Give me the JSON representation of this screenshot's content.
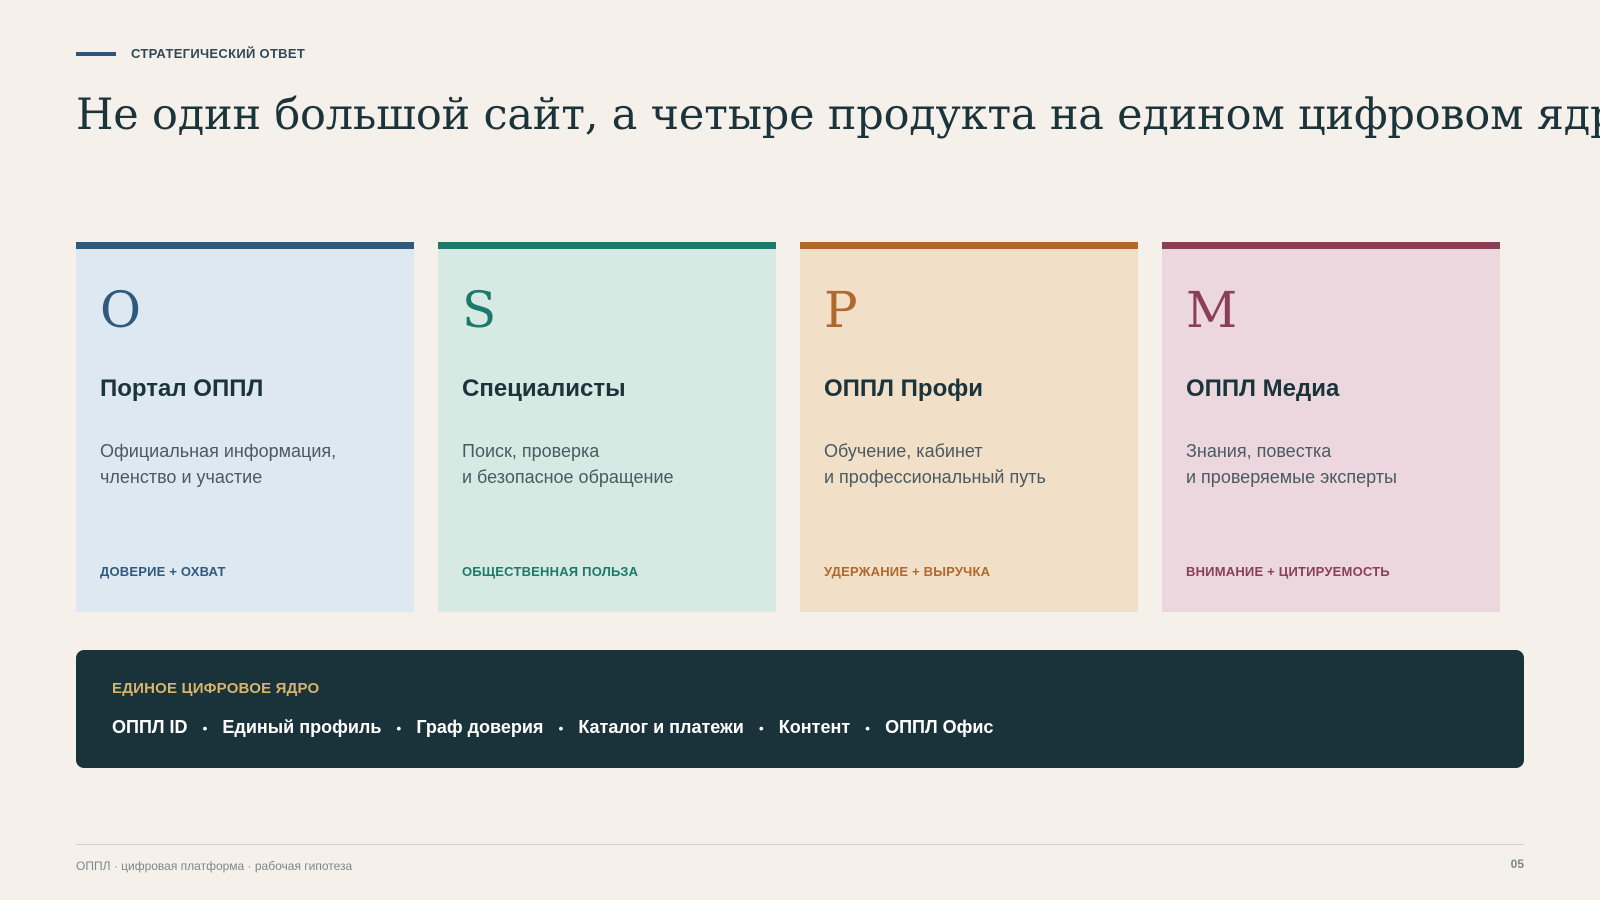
{
  "eyebrow": "СТРАТЕГИЧЕСКИЙ ОТВЕТ",
  "title": "Не один большой сайт, а четыре продукта на едином цифровом ядре",
  "cards": [
    {
      "letter": "O",
      "title": "Портал ОППЛ",
      "description": "Официальная информация,\nчленство и участие",
      "tag": "ДОВЕРИЕ + ОХВАТ",
      "accent_color": "#2f5a7e",
      "background_color": "#dde8f0"
    },
    {
      "letter": "S",
      "title": "Специалисты",
      "description": "Поиск, проверка\nи безопасное обращение",
      "tag": "ОБЩЕСТВЕННАЯ ПОЛЬЗА",
      "accent_color": "#1b7a6a",
      "background_color": "#d7e9e3"
    },
    {
      "letter": "P",
      "title": "ОППЛ Профи",
      "description": "Обучение, кабинет\nи профессиональный путь",
      "tag": "УДЕРЖАНИЕ + ВЫРУЧКА",
      "accent_color": "#b0682d",
      "background_color": "#f1dfc8"
    },
    {
      "letter": "M",
      "title": "ОППЛ Медиа",
      "description": "Знания, повестка\nи проверяемые эксперты",
      "tag": "ВНИМАНИЕ + ЦИТИРУЕМОСТЬ",
      "accent_color": "#8a3f58",
      "background_color": "#ecd7de"
    }
  ],
  "core": {
    "label": "ЕДИНОЕ ЦИФРОВОЕ ЯДРО",
    "items": [
      "ОППЛ ID",
      "Единый профиль",
      "Граф доверия",
      "Каталог и платежи",
      "Контент",
      "ОППЛ Офис"
    ],
    "separator": "•",
    "background_color": "#1a333a",
    "label_color": "#d8b36a"
  },
  "footer": {
    "text": "ОППЛ · цифровая платформа · рабочая гипотеза",
    "page_number": "05"
  }
}
